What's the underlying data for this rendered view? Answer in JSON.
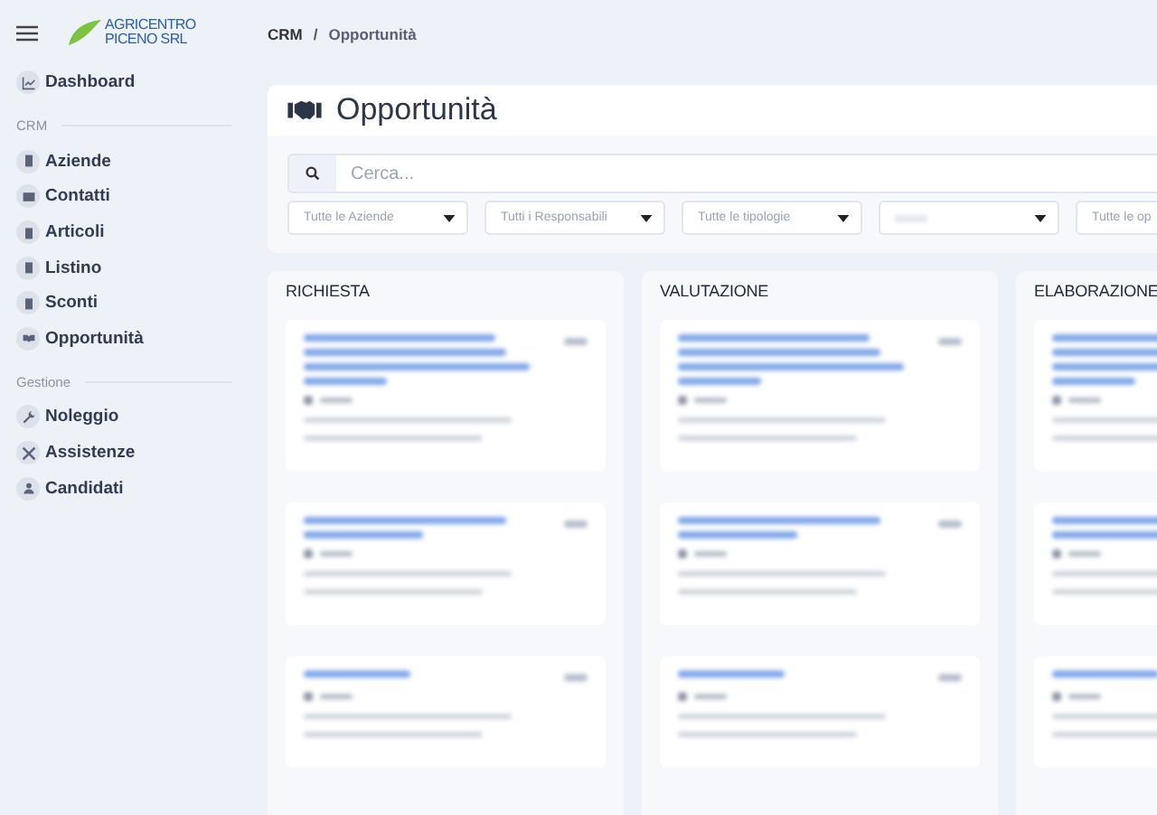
{
  "logo": {
    "line1": "AGRICENTRO",
    "line2": "PICENO SRL"
  },
  "sidebar": {
    "top": [
      {
        "label": "Dashboard"
      }
    ],
    "sections": [
      {
        "title": "CRM",
        "items": [
          {
            "label": "Aziende"
          },
          {
            "label": "Contatti"
          },
          {
            "label": "Articoli"
          },
          {
            "label": "Listino"
          },
          {
            "label": "Sconti"
          },
          {
            "label": "Opportunità"
          }
        ]
      },
      {
        "title": "Gestione",
        "items": [
          {
            "label": "Noleggio"
          },
          {
            "label": "Assistenze"
          },
          {
            "label": "Candidati"
          }
        ]
      }
    ]
  },
  "breadcrumb": [
    "CRM",
    "Opportunità"
  ],
  "breadcrumb_separator": "/",
  "page_title": "Opportunità",
  "search": {
    "placeholder": "Cerca..."
  },
  "filters": [
    {
      "placeholder": "Tutte le Aziende",
      "kind": "text"
    },
    {
      "placeholder": "Tutti i Responsabili",
      "kind": "text"
    },
    {
      "placeholder": "Tutte le tipologie",
      "kind": "text"
    },
    {
      "kind": "blurred"
    },
    {
      "placeholder": "Tutte le op",
      "kind": "text"
    }
  ],
  "columns": [
    {
      "title": "RICHIESTA",
      "cards": [
        {
          "kind": "long"
        },
        {
          "kind": "medium"
        },
        {
          "kind": "short"
        }
      ]
    },
    {
      "title": "VALUTAZIONE",
      "cards": [
        {
          "kind": "long"
        },
        {
          "kind": "medium"
        },
        {
          "kind": "short"
        }
      ]
    },
    {
      "title": "ELABORAZIONE",
      "cards": [
        {
          "kind": "long"
        },
        {
          "kind": "medium"
        },
        {
          "kind": "short"
        }
      ]
    }
  ]
}
